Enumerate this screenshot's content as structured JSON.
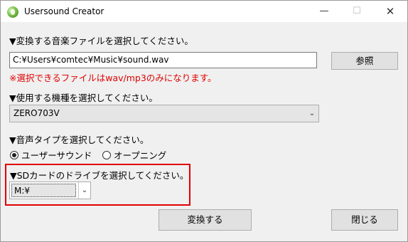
{
  "window": {
    "title": "Usersound Creator",
    "controls": {
      "minimize": "—",
      "maximize": "☐",
      "close": "✕"
    }
  },
  "file_section": {
    "label": "▼変換する音楽ファイルを選択してください。",
    "path_value": "C:¥Users¥comtec¥Music¥sound.wav",
    "browse_label": "参照",
    "warning": "※選択できるファイルはwav/mp3のみになります。"
  },
  "model_section": {
    "label": "▼使用する機種を選択してください。",
    "selected": "ZERO703V"
  },
  "voice_section": {
    "label": "▼音声タイプを選択してください。",
    "options": [
      {
        "label": "ユーザーサウンド",
        "checked": true
      },
      {
        "label": "オープニング",
        "checked": false
      }
    ]
  },
  "sd_section": {
    "label": "▼SDカードのドライブを選択してください。",
    "selected": "M:¥"
  },
  "footer": {
    "convert_label": "変換する",
    "close_label": "閉じる"
  },
  "colors": {
    "highlight": "#e00000",
    "warning_text": "#e00000"
  },
  "icons": {
    "dropdown": "chevron-down-icon",
    "app": "app-icon"
  }
}
